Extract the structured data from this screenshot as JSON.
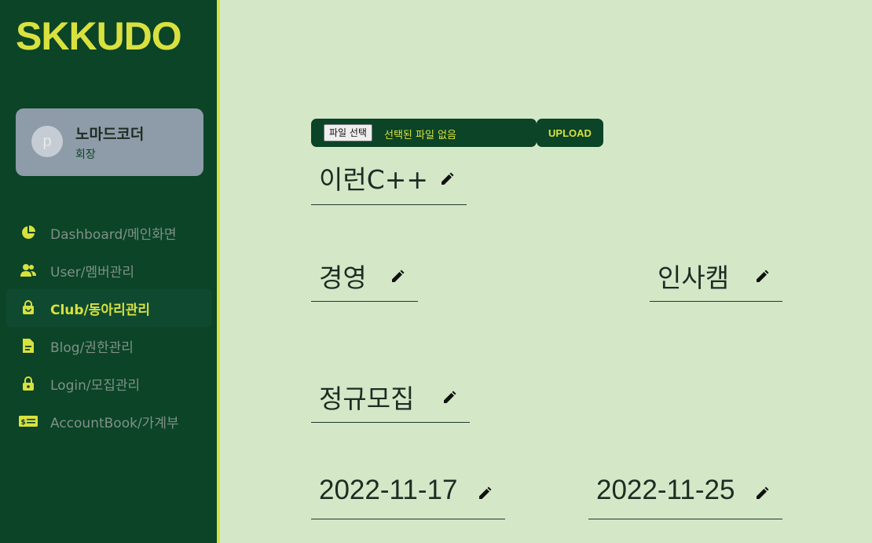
{
  "app": {
    "logo": "SKKUDO"
  },
  "profile": {
    "avatar_letter": "p",
    "name": "노마드코더",
    "role": "회장"
  },
  "nav": {
    "items": [
      {
        "icon": "pie-chart-icon",
        "label": "Dashboard/메인화면",
        "active": false
      },
      {
        "icon": "users-icon",
        "label": "User/멤버관리",
        "active": false
      },
      {
        "icon": "bag-icon",
        "label": "Club/동아리관리",
        "active": true
      },
      {
        "icon": "document-icon",
        "label": "Blog/권한관리",
        "active": false
      },
      {
        "icon": "lock-icon",
        "label": "Login/모집관리",
        "active": false
      },
      {
        "icon": "money-icon",
        "label": "AccountBook/가계부",
        "active": false
      }
    ]
  },
  "upload": {
    "choose_label": "파일 선택",
    "status": "선택된 파일 없음",
    "button_label": "UPLOAD"
  },
  "club": {
    "name": "이런C++",
    "category": "경영",
    "campus": "인사캠",
    "recruit_type": "정규모집",
    "start_date": "2022-11-17",
    "end_date": "2022-11-25"
  },
  "colors": {
    "sidebar": "#0b4426",
    "accent": "#d9e13f",
    "background": "#d4e8c8",
    "card": "#8e9ba8"
  }
}
